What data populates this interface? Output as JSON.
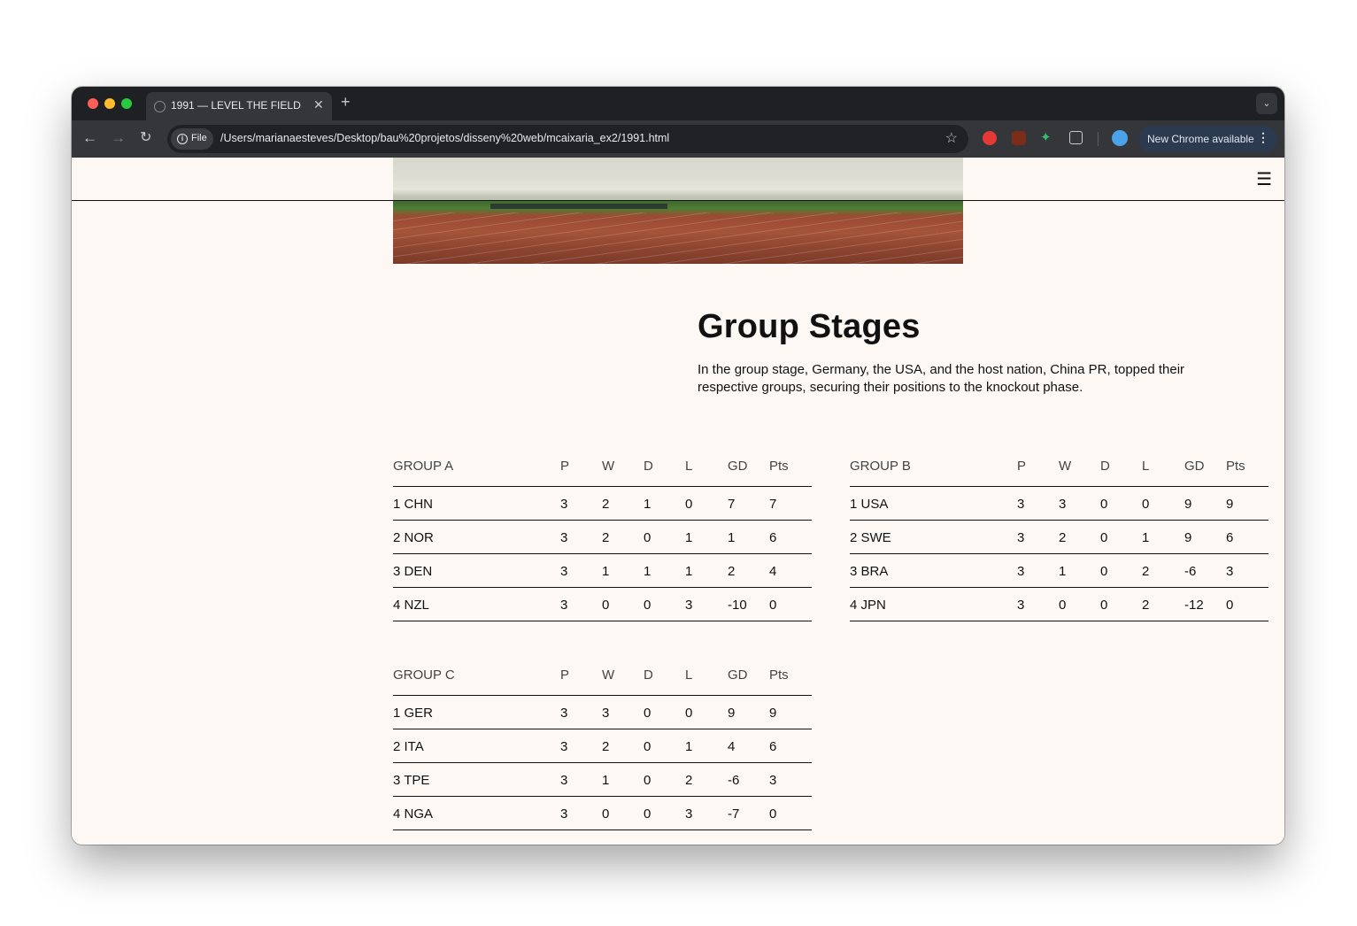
{
  "browser": {
    "tab_title": "1991 — LEVEL THE FIELD",
    "tab_close": "✕",
    "new_tab": "+",
    "chip_label": "File",
    "url": "/Users/marianaesteves/Desktop/bau%20projetos/disseny%20web/mcaixaria_ex2/1991.html",
    "update_label": "New Chrome available"
  },
  "section": {
    "title": "Group Stages",
    "intro": "In the group stage, Germany, the USA, and the host nation, China PR, topped their respective groups, securing their positions to the knockout phase."
  },
  "columns": [
    "P",
    "W",
    "D",
    "L",
    "GD",
    "Pts"
  ],
  "groups": [
    {
      "name": "GROUP A",
      "rows": [
        [
          "1 CHN",
          "3",
          "2",
          "1",
          "0",
          "7",
          "7"
        ],
        [
          "2 NOR",
          "3",
          "2",
          "0",
          "1",
          "1",
          "6"
        ],
        [
          "3 DEN",
          "3",
          "1",
          "1",
          "1",
          "2",
          "4"
        ],
        [
          "4 NZL",
          "3",
          "0",
          "0",
          "3",
          "-10",
          "0"
        ]
      ]
    },
    {
      "name": "GROUP B",
      "rows": [
        [
          "1 USA",
          "3",
          "3",
          "0",
          "0",
          "9",
          "9"
        ],
        [
          "2 SWE",
          "3",
          "2",
          "0",
          "1",
          "9",
          "6"
        ],
        [
          "3 BRA",
          "3",
          "1",
          "0",
          "2",
          "-6",
          "3"
        ],
        [
          "4 JPN",
          "3",
          "0",
          "0",
          "2",
          "-12",
          "0"
        ]
      ]
    },
    {
      "name": "GROUP C",
      "rows": [
        [
          "1 GER",
          "3",
          "3",
          "0",
          "0",
          "9",
          "9"
        ],
        [
          "2 ITA",
          "3",
          "2",
          "0",
          "1",
          "4",
          "6"
        ],
        [
          "3 TPE",
          "3",
          "1",
          "0",
          "2",
          "-6",
          "3"
        ],
        [
          "4 NGA",
          "3",
          "0",
          "0",
          "3",
          "-7",
          "0"
        ]
      ]
    }
  ]
}
